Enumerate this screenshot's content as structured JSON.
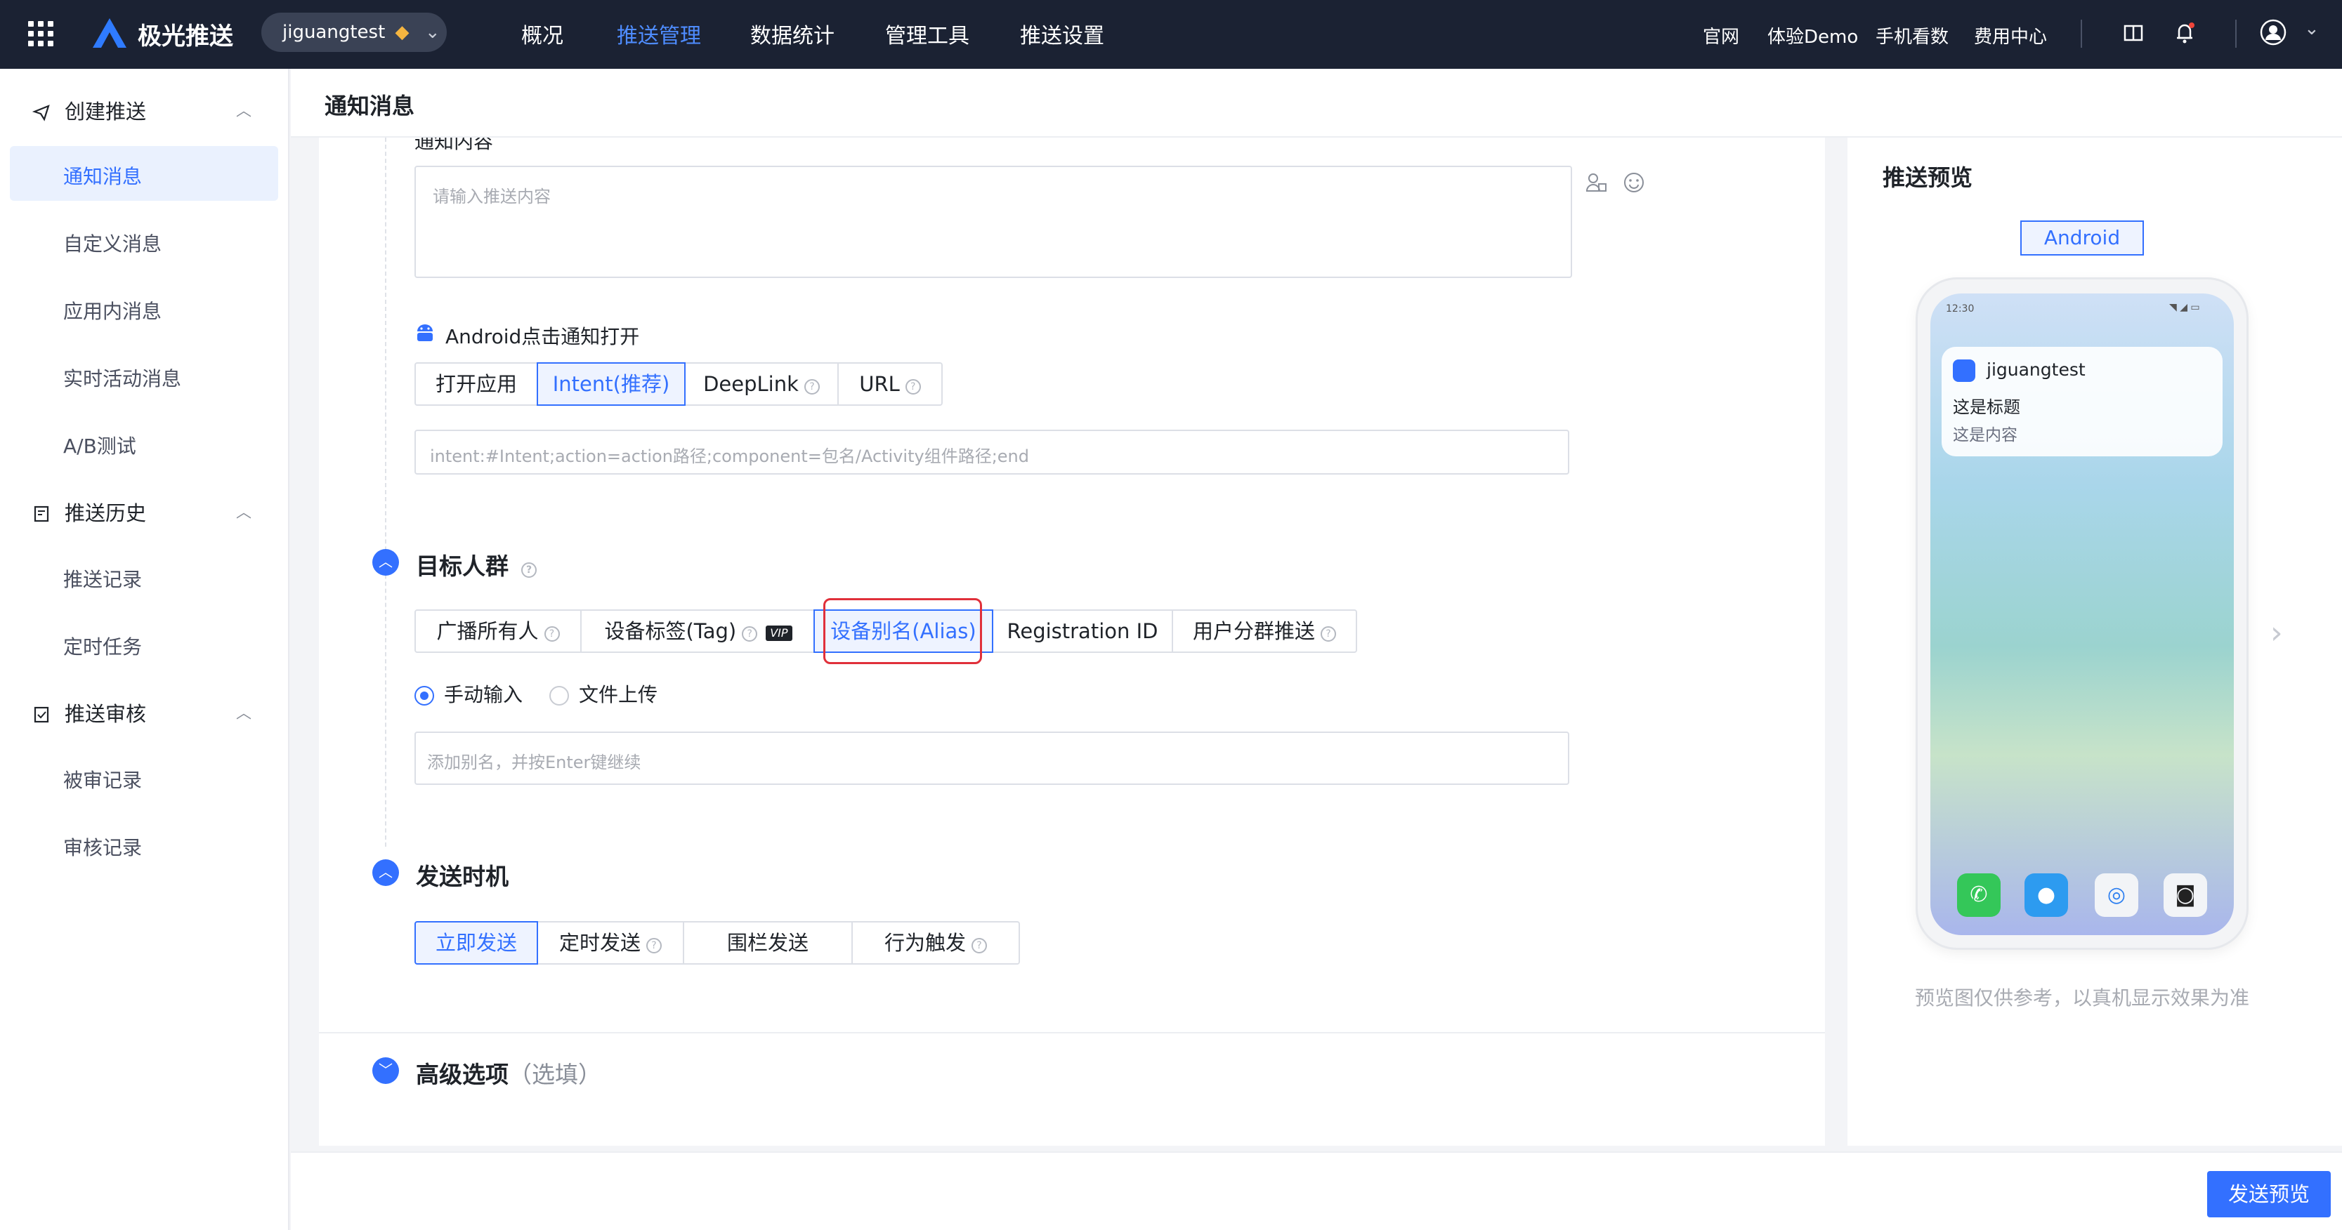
{
  "topbar": {
    "brand": "极光推送",
    "app_name": "jiguangtest",
    "nav": [
      "概况",
      "推送管理",
      "数据统计",
      "管理工具",
      "推送设置"
    ],
    "active_nav": "推送管理",
    "links": [
      "官网",
      "体验Demo",
      "手机看数",
      "费用中心"
    ]
  },
  "sidebar": {
    "groups": [
      {
        "label": "创建推送",
        "items": [
          "通知消息",
          "自定义消息",
          "应用内消息",
          "实时活动消息",
          "A/B测试"
        ]
      },
      {
        "label": "推送历史",
        "items": [
          "推送记录",
          "定时任务"
        ]
      },
      {
        "label": "推送审核",
        "items": [
          "被审记录",
          "审核记录"
        ]
      }
    ],
    "active_item": "通知消息"
  },
  "page": {
    "title": "通知消息"
  },
  "form": {
    "content_label": "通知内容",
    "content_placeholder": "请输入推送内容",
    "android_click_label": "Android点击通知打开",
    "open_modes": [
      "打开应用",
      "Intent(推荐)",
      "DeepLink",
      "URL"
    ],
    "selected_open_mode": "Intent(推荐)",
    "intent_placeholder": "intent:#Intent;action=action路径;component=包名/Activity组件路径;end",
    "target_section": "目标人群",
    "target_tabs": [
      "广播所有人",
      "设备标签(Tag)",
      "设备别名(Alias)",
      "Registration ID",
      "用户分群推送"
    ],
    "vip_badge": "VIP",
    "selected_target": "设备别名(Alias)",
    "input_modes": [
      "手动输入",
      "文件上传"
    ],
    "selected_input_mode": "手动输入",
    "alias_placeholder": "添加别名，并按Enter键继续",
    "timing_section": "发送时机",
    "timing_tabs": [
      "立即发送",
      "定时发送",
      "围栏发送",
      "行为触发"
    ],
    "selected_timing": "立即发送",
    "advanced_section": "高级选项",
    "advanced_hint": "（选填）"
  },
  "preview": {
    "title": "推送预览",
    "platform_tab": "Android",
    "status_time": "12:30",
    "notif_app": "jiguangtest",
    "notif_title": "这是标题",
    "notif_content": "这是内容",
    "note": "预览图仅供参考，以真机显示效果为准"
  },
  "footer": {
    "send_preview_label": "发送预览"
  },
  "colors": {
    "accent": "#3370ff",
    "topbar": "#1b2233",
    "highlight": "#e0303a"
  }
}
